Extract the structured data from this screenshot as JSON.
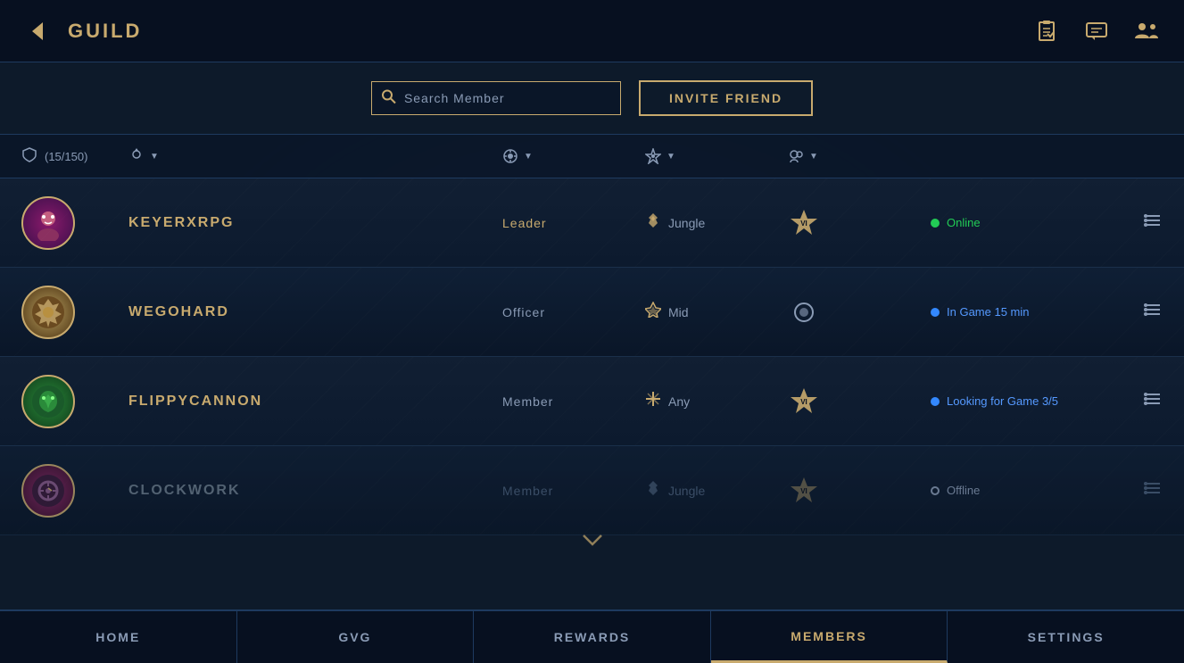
{
  "header": {
    "back_label": "←",
    "title": "GUILD",
    "icons": {
      "clipboard": "📋",
      "chat": "💬",
      "members": "👥"
    }
  },
  "action_bar": {
    "search_placeholder": "Search Member",
    "invite_button_label": "INVITE FRIEND"
  },
  "column_headers": {
    "member_count": "(15/150)",
    "rank": "",
    "position": "",
    "mastery": "",
    "status": ""
  },
  "members": [
    {
      "id": "keyerxrpg",
      "name": "KEYERXRPG",
      "role": "Leader",
      "role_class": "leader",
      "position": "Jungle",
      "position_icon": "🌿",
      "rank_label": "VI",
      "status": "Online",
      "status_class": "online",
      "avatar_class": "avatar-keyerxrpg",
      "avatar_emoji": "🦊"
    },
    {
      "id": "wegohard",
      "name": "WEGOHARD",
      "role": "Officer",
      "role_class": "",
      "position": "Mid",
      "position_icon": "⚡",
      "rank_label": "●",
      "status": "In Game 15 min",
      "status_class": "in-game",
      "avatar_class": "avatar-wegohard",
      "avatar_emoji": "🛡️"
    },
    {
      "id": "flippycannon",
      "name": "FLIPPYCANNON",
      "role": "Member",
      "role_class": "",
      "position": "Any",
      "position_icon": "✳️",
      "rank_label": "VI",
      "status": "Looking for Game 3/5",
      "status_class": "looking",
      "avatar_class": "avatar-flippycannon",
      "avatar_emoji": "🦎"
    },
    {
      "id": "clockwork",
      "name": "CLOCKWORK",
      "role": "Member",
      "role_class": "muted",
      "position": "Jungle",
      "position_icon": "🌿",
      "rank_label": "VI",
      "status": "Offline",
      "status_class": "offline",
      "avatar_class": "avatar-clockwork",
      "avatar_emoji": "⚙️"
    }
  ],
  "nav": {
    "items": [
      {
        "id": "home",
        "label": "HOME",
        "active": false
      },
      {
        "id": "gvg",
        "label": "GVG",
        "active": false
      },
      {
        "id": "rewards",
        "label": "REWARDS",
        "active": false
      },
      {
        "id": "members",
        "label": "MEMBERS",
        "active": true
      },
      {
        "id": "settings",
        "label": "SETTINGS",
        "active": false
      }
    ]
  },
  "colors": {
    "gold": "#c8aa6e",
    "blue_muted": "#8a9bb5",
    "dark_bg": "#0d1a2a",
    "darker_bg": "#071020",
    "online": "#22cc55",
    "in_game": "#5599ff",
    "offline": "#8a9bb5"
  }
}
